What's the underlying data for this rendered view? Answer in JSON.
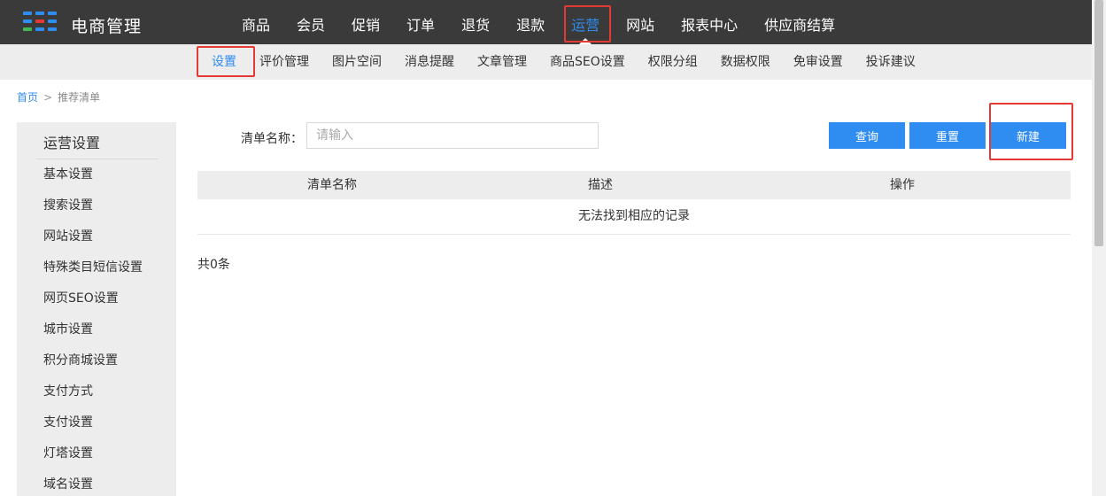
{
  "header": {
    "brand": "电商管理",
    "logo_icon": "grid-logo-icon",
    "nav": [
      {
        "label": "商品",
        "active": false
      },
      {
        "label": "会员",
        "active": false
      },
      {
        "label": "促销",
        "active": false
      },
      {
        "label": "订单",
        "active": false
      },
      {
        "label": "退货",
        "active": false
      },
      {
        "label": "退款",
        "active": false
      },
      {
        "label": "运营",
        "active": true
      },
      {
        "label": "网站",
        "active": false
      },
      {
        "label": "报表中心",
        "active": false
      },
      {
        "label": "供应商结算",
        "active": false
      }
    ]
  },
  "subnav": [
    {
      "label": "设置",
      "active": true
    },
    {
      "label": "评价管理",
      "active": false
    },
    {
      "label": "图片空间",
      "active": false
    },
    {
      "label": "消息提醒",
      "active": false
    },
    {
      "label": "文章管理",
      "active": false
    },
    {
      "label": "商品SEO设置",
      "active": false
    },
    {
      "label": "权限分组",
      "active": false
    },
    {
      "label": "数据权限",
      "active": false
    },
    {
      "label": "免审设置",
      "active": false
    },
    {
      "label": "投诉建议",
      "active": false
    }
  ],
  "breadcrumb": {
    "home": "首页",
    "separator": ">",
    "current": "推荐清单"
  },
  "sidebar": {
    "title": "运营设置",
    "items": [
      "基本设置",
      "搜索设置",
      "网站设置",
      "特殊类目短信设置",
      "网页SEO设置",
      "城市设置",
      "积分商城设置",
      "支付方式",
      "支付设置",
      "灯塔设置",
      "域名设置"
    ]
  },
  "search": {
    "label": "清单名称：",
    "placeholder": "请输入",
    "value": ""
  },
  "buttons": {
    "query": "查询",
    "reset": "重置",
    "create": "新建"
  },
  "table": {
    "columns": [
      "清单名称",
      "描述",
      "操作"
    ],
    "empty_text": "无法找到相应的记录"
  },
  "total": "共0条",
  "colors": {
    "accent": "#2f8cf0",
    "topbar": "#3a3a3a",
    "highlight": "#e53935"
  }
}
